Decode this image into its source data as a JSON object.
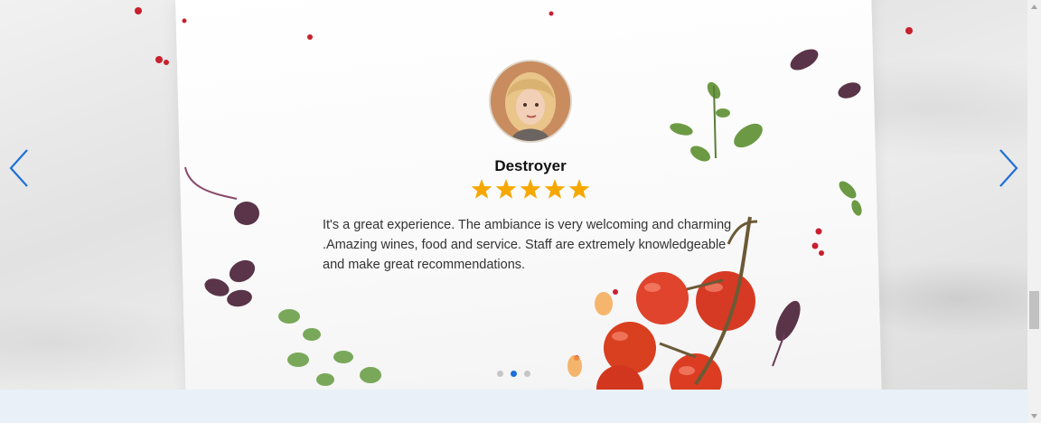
{
  "testimonial": {
    "name": "Destroyer",
    "rating": 5,
    "rating_max": 5,
    "review_lines": [
      "It's a great experience. The ambiance is very welcoming and charming",
      ".Amazing wines, food and service. Staff are extremely knowledgeable",
      "and make great recommendations."
    ]
  },
  "slider": {
    "prev_icon": "chevron-left-icon",
    "next_icon": "chevron-right-icon",
    "total_slides": 3,
    "active_slide": 2
  },
  "colors": {
    "arrow": "#1e6fd9",
    "star": "#f6a800",
    "dot_active": "#1e6fd9",
    "dot_inactive": "#c6c6c6",
    "footer": "#eaf0f8"
  }
}
